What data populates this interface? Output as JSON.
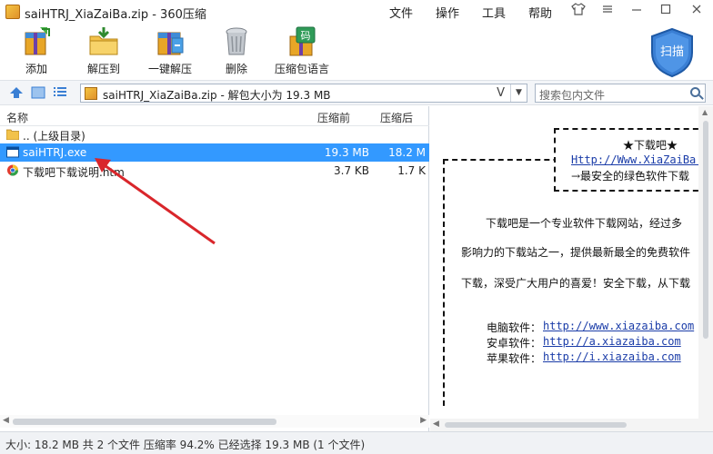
{
  "window": {
    "title": "saiHTRJ_XiaZaiBa.zip - 360压缩",
    "menu": [
      "文件",
      "操作",
      "工具",
      "帮助"
    ]
  },
  "toolbar": {
    "add_label": "添加",
    "extract_to_label": "解压到",
    "one_click_extract_label": "一键解压",
    "delete_label": "删除",
    "comment_label": "压缩包语言",
    "scan_label": "扫描",
    "comment_icon_glyph": "码"
  },
  "addressbar": {
    "path_text": "saiHTRJ_XiaZaiBa.zip - 解包大小为 19.3 MB",
    "path_dropdown_glyph": "V",
    "search_placeholder": "搜索包内文件"
  },
  "filelist": {
    "columns": {
      "name": "名称",
      "compressed": "压缩前",
      "packed": "压缩后"
    },
    "rows": [
      {
        "name": ".. (上级目录)",
        "compressed": "",
        "packed": "",
        "icon": "folder-icon",
        "selected": false
      },
      {
        "name": "saiHTRJ.exe",
        "compressed": "19.3 MB",
        "packed": "18.2 M",
        "icon": "exe-icon",
        "selected": true
      },
      {
        "name": "下载吧下载说明.htm",
        "compressed": "3.7 KB",
        "packed": "1.7 K",
        "icon": "html-file-icon",
        "selected": false
      }
    ]
  },
  "preview": {
    "box_title": "★下载吧★",
    "box_link": "Http://Www.XiaZaiBa.",
    "box_slogan": "→最安全的绿色软件下载",
    "para1": "下载吧是一个专业软件下载网站，经过多",
    "para2": "影响力的下载站之一，提供最新最全的免费软件",
    "para3": "下载，深受广大用户的喜爱！安全下载，从下载",
    "links": [
      {
        "label": "电脑软件：",
        "url": "http://www.xiazaiba.com"
      },
      {
        "label": "安卓软件：",
        "url": "http://a.xiazaiba.com"
      },
      {
        "label": "苹果软件：",
        "url": "http://i.xiazaiba.com"
      }
    ]
  },
  "statusbar": {
    "text": "大小: 18.2 MB 共 2 个文件 压缩率 94.2% 已经选择 19.3 MB (1 个文件)"
  },
  "colors": {
    "selection": "#3399ff",
    "annotation_arrow": "#d9262b",
    "link": "#1a3ca8"
  }
}
